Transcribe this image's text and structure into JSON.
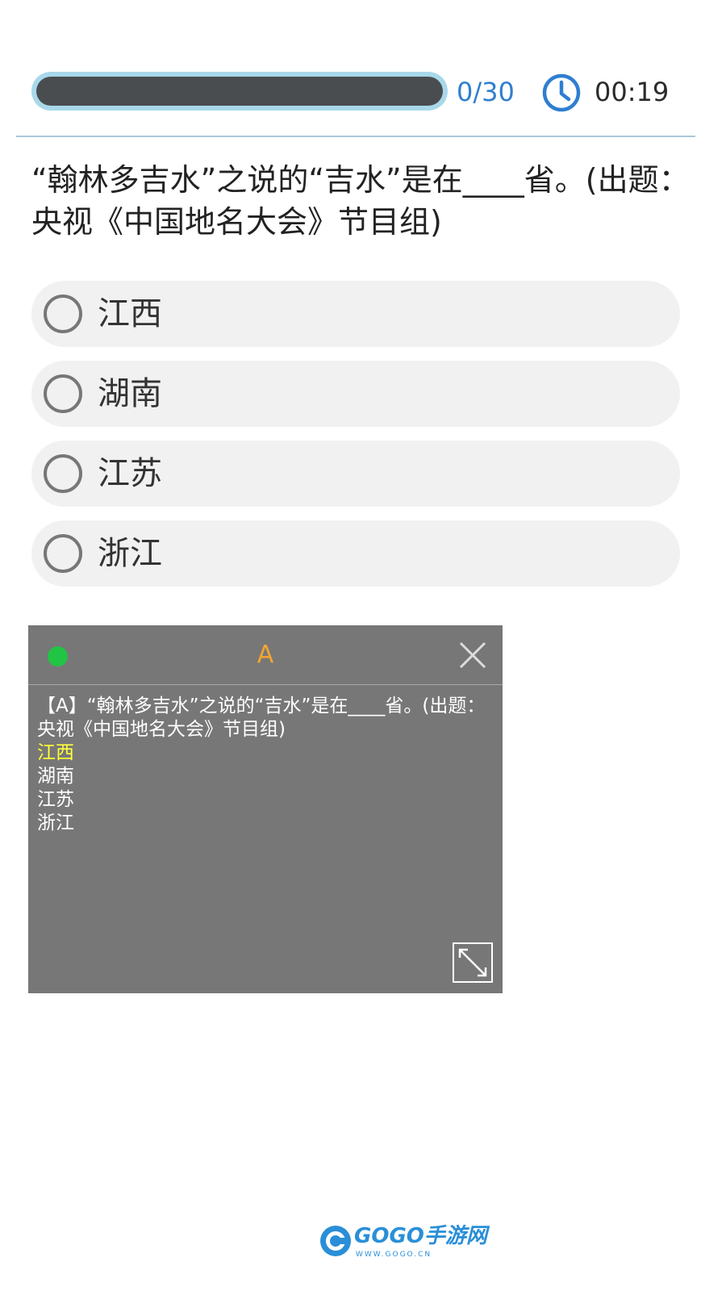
{
  "status_bar": {
    "progress_fraction": 0.0,
    "progress_text": "0/30",
    "timer": "00:19",
    "accent_color": "#2f7fd0"
  },
  "question": {
    "text": "“翰林多吉水”之说的“吉水”是在____省。(出题：央视《中国地名大会》节目组)"
  },
  "options": [
    {
      "label": "江西",
      "selected": false
    },
    {
      "label": "湖南",
      "selected": false
    },
    {
      "label": "江苏",
      "selected": false
    },
    {
      "label": "浙江",
      "selected": false
    }
  ],
  "overlay": {
    "status_color": "#22c444",
    "title": "A",
    "question_text": "【A】“翰林多吉水”之说的“吉水”是在____省。(出题：央视《中国地名大会》节目组)",
    "answers": [
      "江西",
      "湖南",
      "江苏",
      "浙江"
    ],
    "highlighted_answer": "江西",
    "highlight_color": "#ffff3a"
  },
  "watermark": {
    "name": "GOGO手游网",
    "url": "WWW.GOGO.CN"
  },
  "icons": {
    "clock": "clock-icon",
    "close": "close-icon",
    "resize": "resize-icon",
    "radio": "radio-unchecked-icon"
  }
}
